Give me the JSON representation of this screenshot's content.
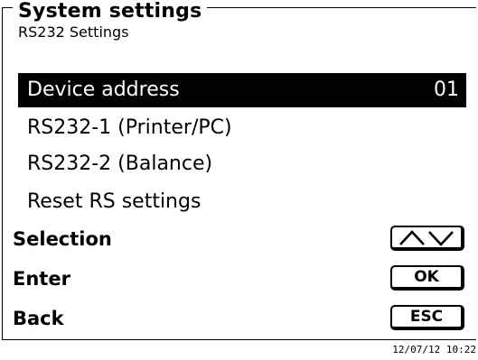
{
  "screen": {
    "title": "System settings",
    "subtitle": "RS232 Settings"
  },
  "menu": {
    "items": [
      {
        "label": "Device address",
        "value": "01",
        "selected": true
      },
      {
        "label": "RS232-1 (Printer/PC)",
        "value": "",
        "selected": false
      },
      {
        "label": "RS232-2 (Balance)",
        "value": "",
        "selected": false
      },
      {
        "label": "Reset RS settings",
        "value": "",
        "selected": false
      }
    ]
  },
  "softkeys": {
    "selection_label": "Selection",
    "selection_icon": "up-down-arrows-icon",
    "enter_label": "Enter",
    "enter_key": "OK",
    "back_label": "Back",
    "back_key": "ESC"
  },
  "status": {
    "timestamp": "12/07/12 10:22"
  },
  "colors": {
    "highlight_bg": "#000000",
    "highlight_fg": "#ffffff"
  }
}
